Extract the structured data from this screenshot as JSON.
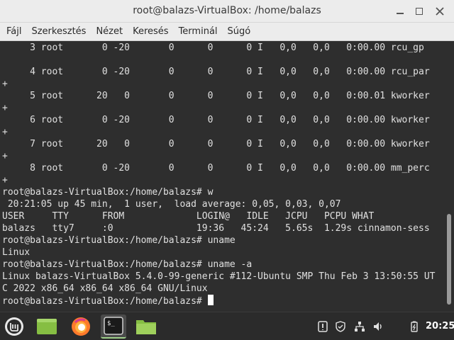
{
  "window": {
    "title": "root@balazs-VirtualBox: /home/balazs",
    "controls": [
      "minimize-icon",
      "maximize-icon",
      "close-icon"
    ]
  },
  "menubar": {
    "items": [
      "Fájl",
      "Szerkesztés",
      "Nézet",
      "Keresés",
      "Terminál",
      "Súgó"
    ]
  },
  "terminal": {
    "lines": [
      "     3 root       0 -20       0      0      0 I   0,0   0,0   0:00.00 rcu_gp",
      "",
      "     4 root       0 -20       0      0      0 I   0,0   0,0   0:00.00 rcu_par",
      "+",
      "     5 root      20   0       0      0      0 I   0,0   0,0   0:00.01 kworker",
      "+",
      "     6 root       0 -20       0      0      0 I   0,0   0,0   0:00.00 kworker",
      "+",
      "     7 root      20   0       0      0      0 I   0,0   0,0   0:00.00 kworker",
      "+",
      "     8 root       0 -20       0      0      0 I   0,0   0,0   0:00.00 mm_perc",
      "+",
      "root@balazs-VirtualBox:/home/balazs# w",
      " 20:21:05 up 45 min,  1 user,  load average: 0,05, 0,03, 0,07",
      "USER     TTY      FROM             LOGIN@   IDLE   JCPU   PCPU WHAT",
      "balazs   tty7     :0               19:36   45:24   5.65s  1.29s cinnamon-sess",
      "root@balazs-VirtualBox:/home/balazs# uname",
      "Linux",
      "root@balazs-VirtualBox:/home/balazs# uname -a",
      "Linux balazs-VirtualBox 5.4.0-99-generic #112-Ubuntu SMP Thu Feb 3 13:50:55 UT",
      "C 2022 x86_64 x86_64 x86_64 GNU/Linux",
      "root@balazs-VirtualBox:/home/balazs# "
    ]
  },
  "taskbar": {
    "apps": [
      "mint-menu-icon",
      "show-desktop-icon",
      "firefox-icon",
      "terminal-icon",
      "files-icon"
    ],
    "tray": [
      "update-manager-icon",
      "shield-icon",
      "network-icon",
      "volume-icon",
      "battery-icon"
    ],
    "clock": "20:25"
  },
  "colors": {
    "terminal_bg": "#2e2e2e",
    "terminal_fg": "#e0e0e0",
    "mint_green": "#86be43",
    "firefox_orange": "#ff7a2b"
  }
}
